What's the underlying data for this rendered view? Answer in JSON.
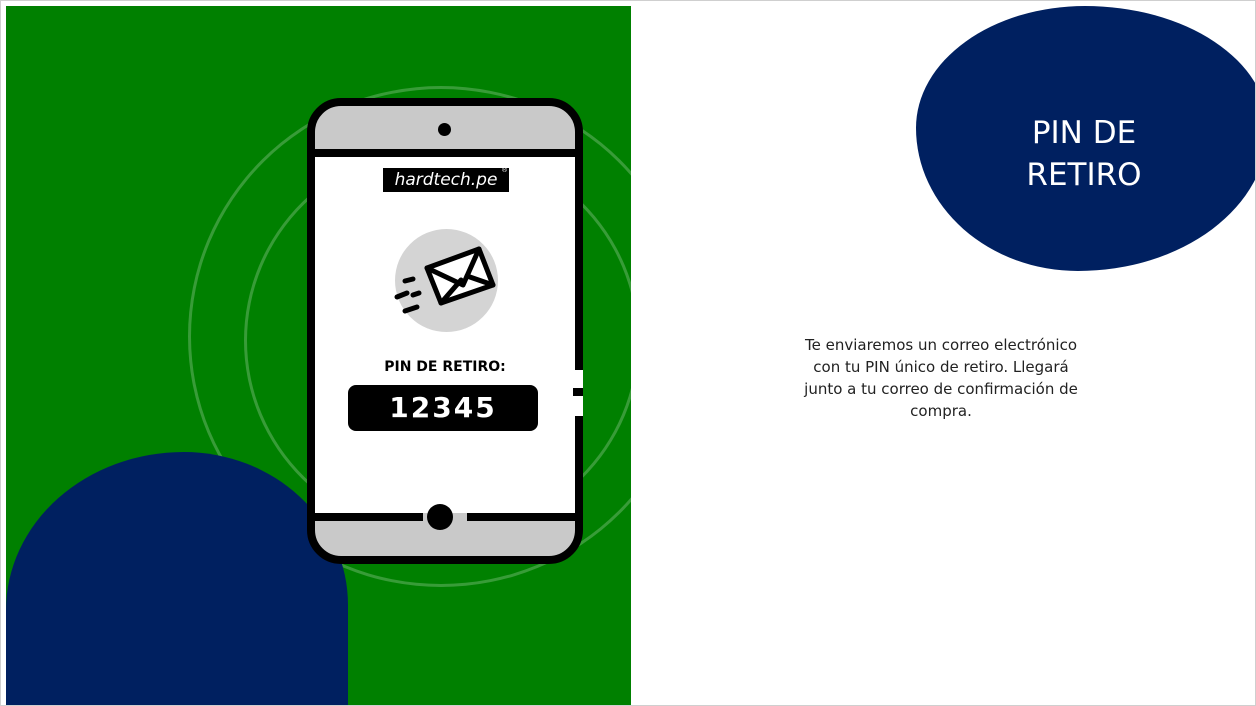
{
  "slide": {
    "brand": "hardtech.pe",
    "brand_mark": "®",
    "pin_label": "PIN DE RETIRO:",
    "pin_code": "12345",
    "title_line1": "PIN DE",
    "title_line2": "RETIRO",
    "body_line1": "Te enviaremos un correo electrónico",
    "body_line2": "con tu PIN único de retiro. Llegará",
    "body_line3": "junto a tu correo de confirmación de",
    "body_line4": "compra."
  },
  "icons": {
    "mail": "envelope-icon"
  },
  "colors": {
    "green": "#008000",
    "navy": "#002060",
    "white": "#ffffff",
    "black": "#000000",
    "phone_gray": "#c9c9c9"
  }
}
